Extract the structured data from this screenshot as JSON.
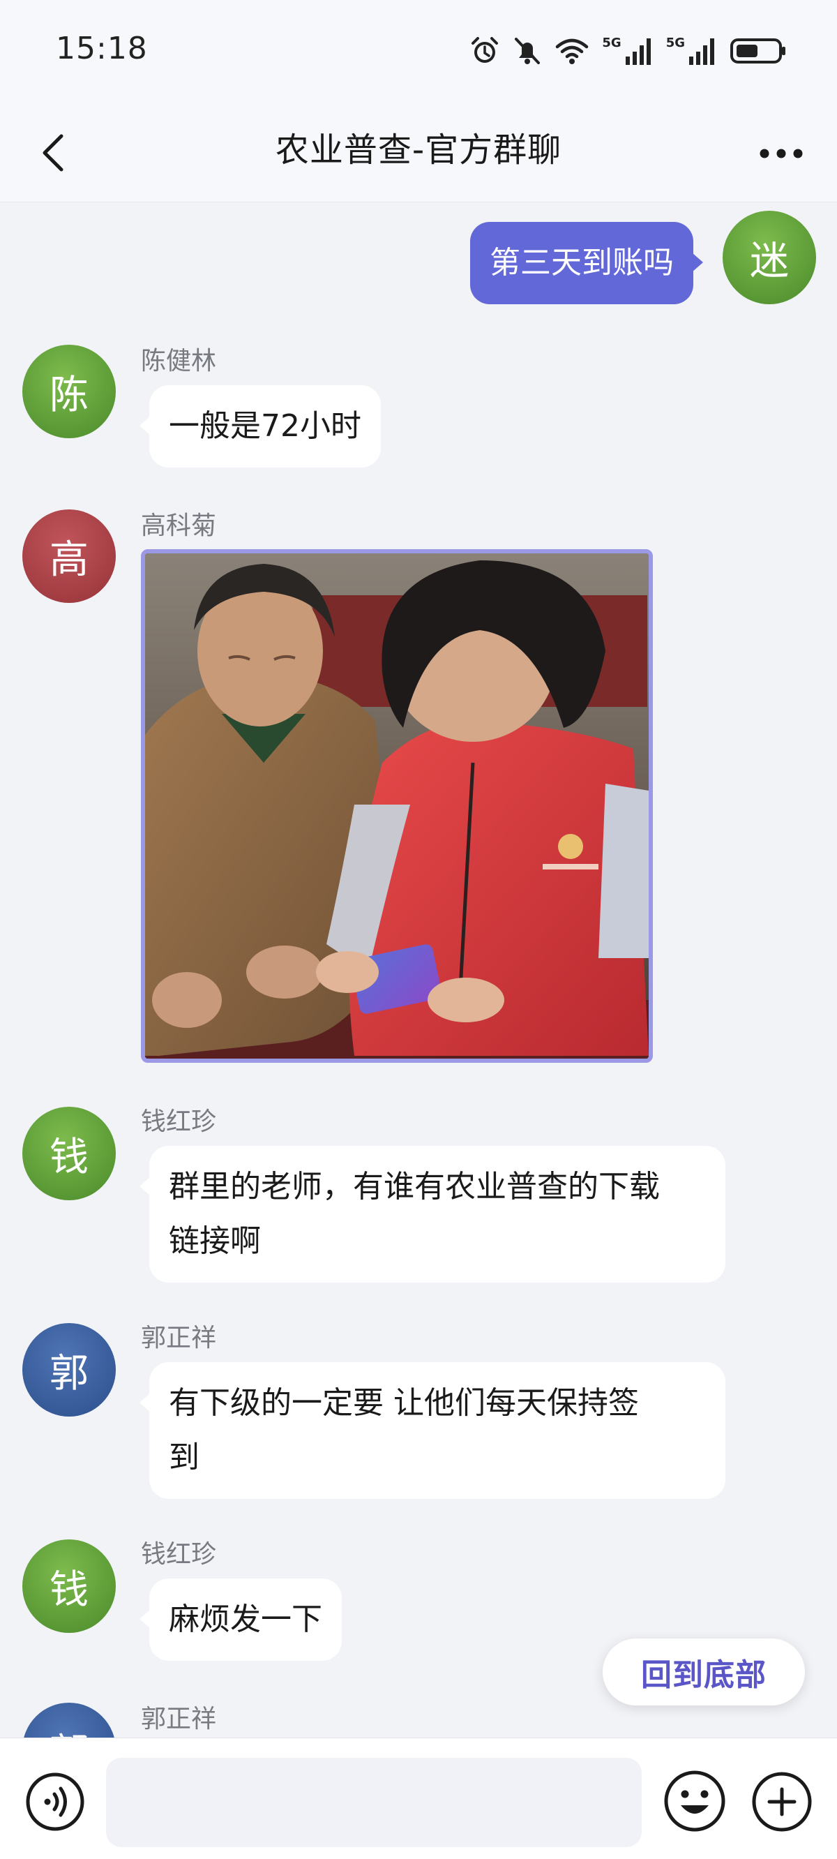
{
  "status_bar": {
    "time": "15:18",
    "network_1": "5G",
    "network_2": "5G",
    "icons": [
      "alarm-icon",
      "mute-icon",
      "wifi-icon",
      "signal-icon",
      "signal-icon",
      "battery-icon"
    ]
  },
  "header": {
    "title": "农业普查-官方群聊",
    "back_icon": "chevron-left-icon",
    "more_icon": "more-dots-icon"
  },
  "messages": [
    {
      "sender": "",
      "avatar_text": "迷",
      "avatar_color": "#5a9a35",
      "text": "第三天到账吗",
      "mine": true
    },
    {
      "sender": "陈健林",
      "avatar_text": "陈",
      "avatar_color": "#5a9a35",
      "text": "一般是72小时"
    },
    {
      "sender": "高科菊",
      "avatar_text": "高",
      "avatar_color": "#a8434a",
      "type": "image"
    },
    {
      "sender": "钱红珍",
      "avatar_text": "钱",
      "avatar_color": "#5a9a35",
      "text_line1": "群里的老师，有谁有农业普查的下载",
      "text_line2": "链接啊"
    },
    {
      "sender": "郭正祥",
      "avatar_text": "郭",
      "avatar_color": "#3a5f9e",
      "text_line1": "有下级的一定要 让他们每天保持签",
      "text_line2": "到"
    },
    {
      "sender": "钱红珍",
      "avatar_text": "钱",
      "avatar_color": "#5a9a35",
      "text": "麻烦发一下"
    },
    {
      "sender": "郭正祥",
      "avatar_text": "郭",
      "avatar_color": "#3a5f9e"
    }
  ],
  "floating_button": {
    "label": "回到底部"
  },
  "input_bar": {
    "placeholder": "",
    "voice_icon": "voice-icon",
    "emoji_icon": "emoji-icon",
    "plus_icon": "plus-circle-icon"
  },
  "colors": {
    "accent": "#6368d8",
    "background": "#f2f3f7",
    "floating_text": "#5a56c8"
  }
}
